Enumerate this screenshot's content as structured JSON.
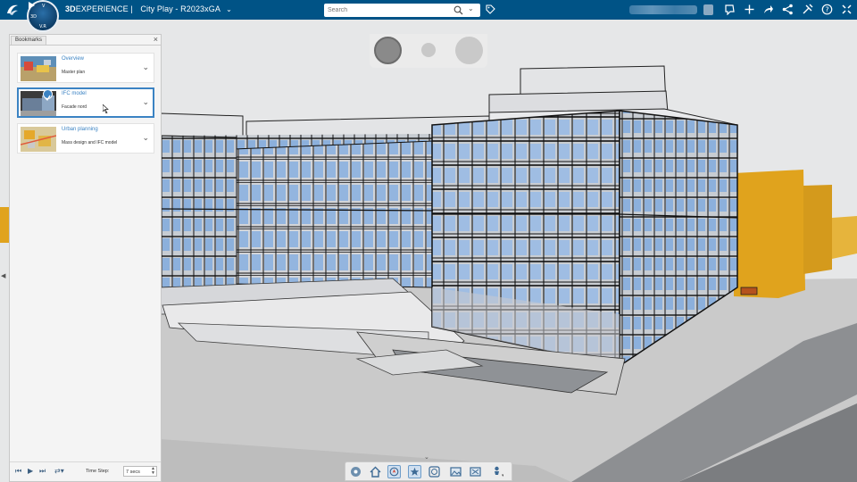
{
  "header": {
    "brand_bold": "3D",
    "brand_rest": "EXPERIENCE",
    "separator": "|",
    "app_name": "City Play - R2023xGA",
    "search": {
      "placeholder": "Search"
    }
  },
  "compass": {
    "labels": [
      "V",
      "3D",
      "V.R"
    ]
  },
  "bookmarks": {
    "tab_label": "Bookmarks",
    "items": [
      {
        "title": "Overview",
        "subtitle": "Master plan",
        "selected": false
      },
      {
        "title": "IFC model",
        "subtitle": "Facade nord",
        "selected": true
      },
      {
        "title": "Urban planning",
        "subtitle": "Mass design and IFC model",
        "selected": false
      }
    ],
    "footer": {
      "time_step_label": "Time Step:",
      "time_step_value": "7 secs"
    }
  },
  "colors": {
    "topbar": "#005386",
    "accent": "#3b83c3",
    "building_glass": "#8fb3dc",
    "mass_buildings": "#e0a31d",
    "road": "#7b7d80"
  },
  "icons": {
    "topbar_right": [
      "chat-icon",
      "add-icon",
      "share-icon",
      "network-icon",
      "tools-icon",
      "help-icon",
      "fullscreen-icon"
    ],
    "bottom_toolbar": [
      "compass-icon",
      "home-icon",
      "navigation-icon",
      "bookmark-star-icon",
      "info-icon",
      "image-icon",
      "image-capture-icon",
      "street-view-icon"
    ]
  }
}
